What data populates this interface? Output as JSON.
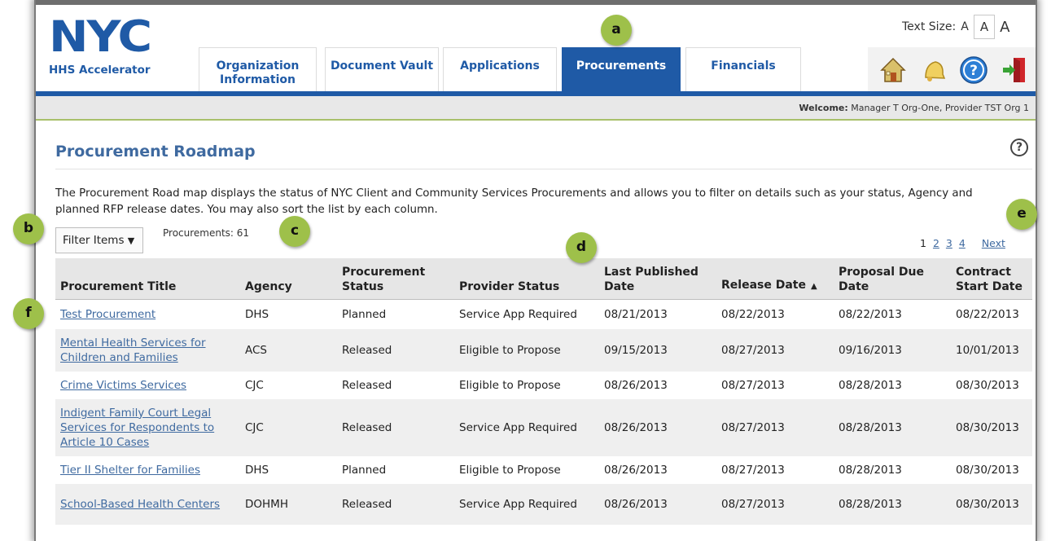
{
  "header": {
    "logo_text": "NYC",
    "logo_subtitle": "HHS Accelerator",
    "text_size_label": "Text Size:",
    "text_size_options": [
      "A",
      "A",
      "A"
    ],
    "tabs": [
      {
        "label": "Organization Information",
        "active": false
      },
      {
        "label": "Document Vault",
        "active": false
      },
      {
        "label": "Applications",
        "active": false
      },
      {
        "label": "Procurements",
        "active": true
      },
      {
        "label": "Financials",
        "active": false
      }
    ],
    "icons": [
      "home-icon",
      "notifications-bell-icon",
      "help-icon",
      "logout-icon"
    ],
    "colors": {
      "brand_blue": "#1f5aa6",
      "accent_green": "#a8c06a"
    }
  },
  "welcome": {
    "label": "Welcome:",
    "user": "Manager T Org-One, Provider TST Org 1"
  },
  "main": {
    "title": "Procurement Roadmap",
    "description": "The Procurement Road map displays the status of NYC Client and Community Services Procurements and allows you to filter on details such as your status, Agency and planned RFP release dates. You may also sort the list by each column.",
    "filter_label": "Filter Items",
    "count_text": "Procurements: 61",
    "pager": {
      "pages": [
        "1",
        "2",
        "3",
        "4"
      ],
      "current": "1",
      "next_label": "Next"
    }
  },
  "table": {
    "columns": [
      "Procurement Title",
      "Agency",
      "Procurement Status",
      "Provider Status",
      "Last Published Date",
      "Release Date",
      "Proposal Due Date",
      "Contract Start Date"
    ],
    "sorted_column": "Release Date",
    "rows": [
      [
        "Test Procurement",
        "DHS",
        "Planned",
        "Service App Required",
        "08/21/2013",
        "08/22/2013",
        "08/22/2013",
        "08/22/2013"
      ],
      [
        "Mental Health Services for Children and Families",
        "ACS",
        "Released",
        "Eligible to Propose",
        "09/15/2013",
        "08/27/2013",
        "09/16/2013",
        "10/01/2013"
      ],
      [
        "Crime Victims Services",
        "CJC",
        "Released",
        "Eligible to Propose",
        "08/26/2013",
        "08/27/2013",
        "08/28/2013",
        "08/30/2013"
      ],
      [
        "Indigent Family Court Legal Services for Respondents to Article 10 Cases",
        "CJC",
        "Released",
        "Service App Required",
        "08/26/2013",
        "08/27/2013",
        "08/28/2013",
        "08/30/2013"
      ],
      [
        "Tier II Shelter for Families",
        "DHS",
        "Planned",
        "Eligible to Propose",
        "08/26/2013",
        "08/27/2013",
        "08/28/2013",
        "08/30/2013"
      ],
      [
        "School-Based Health Centers",
        "DOHMH",
        "Released",
        "Service App Required",
        "08/26/2013",
        "08/27/2013",
        "08/28/2013",
        "08/30/2013"
      ]
    ]
  },
  "callouts": [
    "a",
    "b",
    "c",
    "d",
    "e",
    "f"
  ]
}
